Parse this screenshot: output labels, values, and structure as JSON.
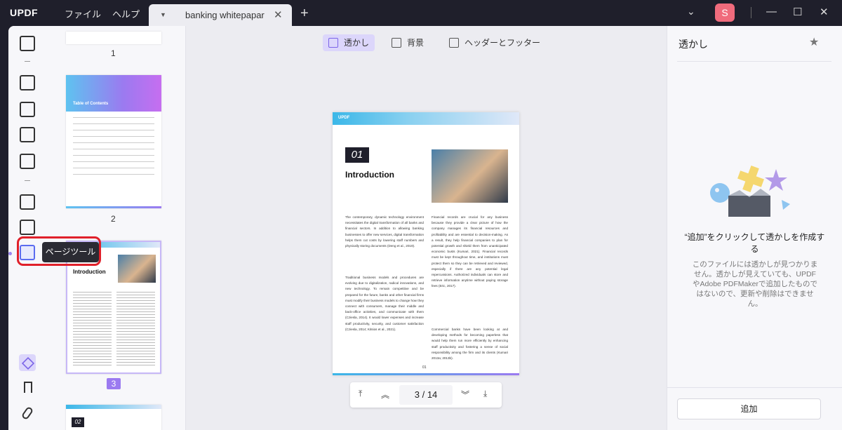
{
  "app": {
    "logo": "UPDF"
  },
  "menu": {
    "file": "ファイル",
    "help": "ヘルプ"
  },
  "tab": {
    "name": "banking whitepapar"
  },
  "user": {
    "avatar_initial": "S"
  },
  "tooltip": {
    "text": "ページツール"
  },
  "thumbnails": {
    "pages": [
      "1",
      "2",
      "3"
    ],
    "toc_title": "Table of Contents",
    "page3_intro": "Introduction",
    "page4_num": "02"
  },
  "tools": {
    "watermark": "透かし",
    "background": "背景",
    "header_footer": "ヘッダーとフッター"
  },
  "page": {
    "logo": "UPDF",
    "section_number": "01",
    "heading": "Introduction",
    "col1_p1": "The contemporary, dynamic technology environment necessitates the digital transformation of all banks and financial sectors. In addition to allowing banking businesses to offer new services, digital transformation helps them cut costs by lowering staff numbers and physically storing documents (Deng et al., 2019).",
    "col1_p2": "Traditional business models and procedures are evolving due to digitalization, radical innovations, and new technology. To remain competitive and be prepared for the future, banks and other financial firms must modify their business models to change how they connect with consumers, manage their middle and back-office activities, and communicate with them (Cziesla, 2014). It would lower expenses and increase staff productivity, security, and customer satisfaction (Cziesla, 2014; Kitsios et al., 2021).",
    "col2_p1": "Financial records are crucial for any business because they provide a clear picture of how the company manages its financial resources and profitability and are essential to decision-making. As a result, they help financial companies to plan for potential growth and shield them from unanticipated economic busts (Kumari, 2021). Financial records must be kept throughout time, and institutions must protect them so they can be retrieved and reviewed, especially if there are any potential legal repercussions. Authorized individuals can store and retrieve information anytime without paying storage fees (Eric, 2017).",
    "col2_p2": "Commercial banks have been looking at and developing methods for becoming paperless that would help them run more efficiently by enhancing staff productivity and fostering a sense of social responsibility among the firm and its clients (Kumari 2013a; 2013b).",
    "footer_num": "01"
  },
  "pagenav": {
    "current": "3",
    "separator": "/",
    "total": "14"
  },
  "right_panel": {
    "title": "透かし",
    "main_text": "“追加”をクリックして透かしを作成する",
    "sub_text": "このファイルには透かしが見つかりません。透かしが見えていても、UPDFやAdobe PDFMakerで追加したものではないので、更新や削除はできません。",
    "add_button": "追加"
  },
  "colors": {
    "accent": "#9b7af0",
    "highlight": "#e0202a",
    "titlebar": "#1f1f2b"
  },
  "icons": [
    "reader-icon",
    "highlighter-icon",
    "edit-icon",
    "form-icon",
    "sign-icon",
    "organize-icon",
    "crop-icon",
    "page-tools-icon",
    "layers-icon",
    "bookmark-icon",
    "attachment-icon",
    "star-icon"
  ]
}
